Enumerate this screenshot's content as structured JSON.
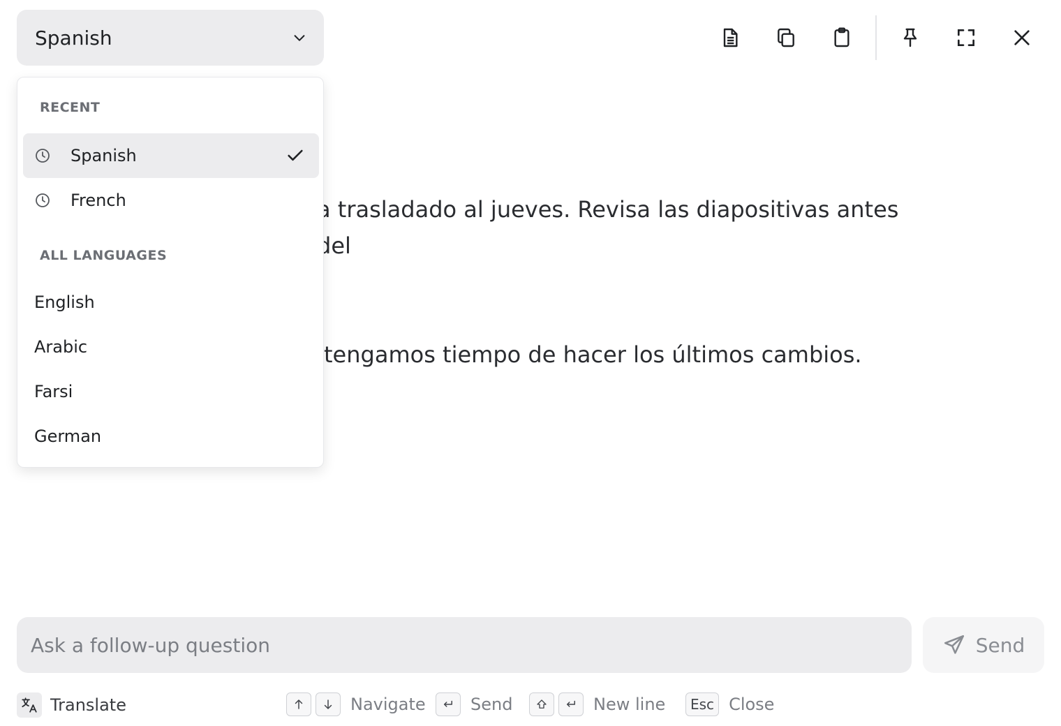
{
  "language_select": {
    "value": "Spanish",
    "icon": "chevron-down-icon"
  },
  "toolbar": {
    "buttons": [
      {
        "name": "document-icon"
      },
      {
        "name": "copy-icon"
      },
      {
        "name": "clipboard-icon"
      },
      {
        "name": "pin-icon"
      },
      {
        "name": "fullscreen-icon"
      },
      {
        "name": "close-icon"
      }
    ]
  },
  "output": {
    "line1": "a trasladado al jueves. Revisa las diapositivas antes del",
    "line2": "tengamos tiempo de hacer los últimos cambios."
  },
  "dropdown": {
    "recent_label": "RECENT",
    "recent": [
      {
        "label": "Spanish",
        "selected": true
      },
      {
        "label": "French",
        "selected": false
      }
    ],
    "all_label": "ALL LANGUAGES",
    "all": [
      {
        "label": "English"
      },
      {
        "label": "Arabic"
      },
      {
        "label": "Farsi"
      },
      {
        "label": "German"
      }
    ]
  },
  "composer": {
    "placeholder": "Ask a follow-up question",
    "value": ""
  },
  "send_button": {
    "label": "Send"
  },
  "footer": {
    "mode_label": "Translate",
    "hints": {
      "navigate": "Navigate",
      "send": "Send",
      "new_line": "New line",
      "esc_key": "Esc",
      "close": "Close"
    }
  },
  "colors": {
    "surface": "#ececee",
    "text": "#1f2124",
    "muted": "#7b7e84"
  }
}
